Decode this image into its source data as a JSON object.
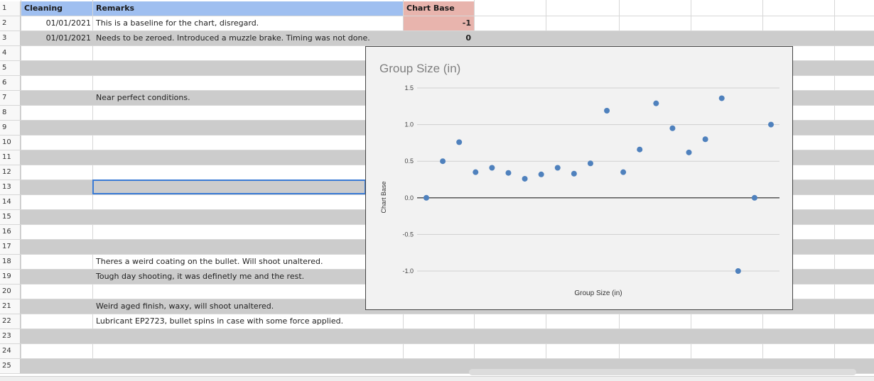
{
  "headers": {
    "cleaning": "Cleaning",
    "remarks": "Remarks",
    "chart_base": "Chart Base"
  },
  "row_numbers": [
    "1",
    "2",
    "3",
    "4",
    "5",
    "6",
    "7",
    "8",
    "9",
    "10",
    "11",
    "12",
    "13",
    "14",
    "15",
    "16",
    "17",
    "18",
    "19",
    "20",
    "21",
    "22",
    "23",
    "24",
    "25"
  ],
  "rows": {
    "r2": {
      "date": "01/01/2021",
      "remark": "This is a baseline for the chart, disregard.",
      "value": "-1"
    },
    "r3": {
      "date": "01/01/2021",
      "remark": "Needs to be zeroed. Introduced a muzzle brake. Timing was not done.",
      "value": "0"
    },
    "r7": {
      "remark": "Near perfect conditions."
    },
    "r18": {
      "remark": "Theres a weird coating on the bullet. Will shoot unaltered."
    },
    "r19": {
      "remark": "Tough day shooting, it was definetly me and the rest."
    },
    "r21": {
      "remark": "Weird aged finish, waxy, will shoot unaltered."
    },
    "r22": {
      "remark": "Lubricant EP2723, bullet spins in case with some force applied."
    }
  },
  "colors": {
    "header_blue": "#9fbff0",
    "header_red": "#e8b4ad",
    "row_shade": "#cccccc",
    "point": "#4f81bd",
    "selection": "#3a7bd5"
  },
  "chart_data": {
    "type": "scatter",
    "title": "Group Size (in)",
    "xlabel": "Group Size (in)",
    "ylabel": "Chart Base",
    "ylim": [
      -1.0,
      1.5
    ],
    "yticks": [
      "1.5",
      "1.0",
      "0.5",
      "0.0",
      "-0.5",
      "-1.0"
    ],
    "grid": true,
    "legend": "none",
    "series": [
      {
        "x": [
          1,
          2,
          3,
          4,
          5,
          6,
          7,
          8,
          9,
          10,
          11,
          12,
          13,
          14,
          15,
          16,
          17,
          18,
          19,
          20,
          21,
          22
        ],
        "values": [
          0,
          0.5,
          0.76,
          0.35,
          0.41,
          0.34,
          0.26,
          0.32,
          0.41,
          0.33,
          0.47,
          1.19,
          0.35,
          0.66,
          1.29,
          0.95,
          0.62,
          0.8,
          1.36,
          -1.0,
          0,
          1.0
        ]
      }
    ]
  }
}
